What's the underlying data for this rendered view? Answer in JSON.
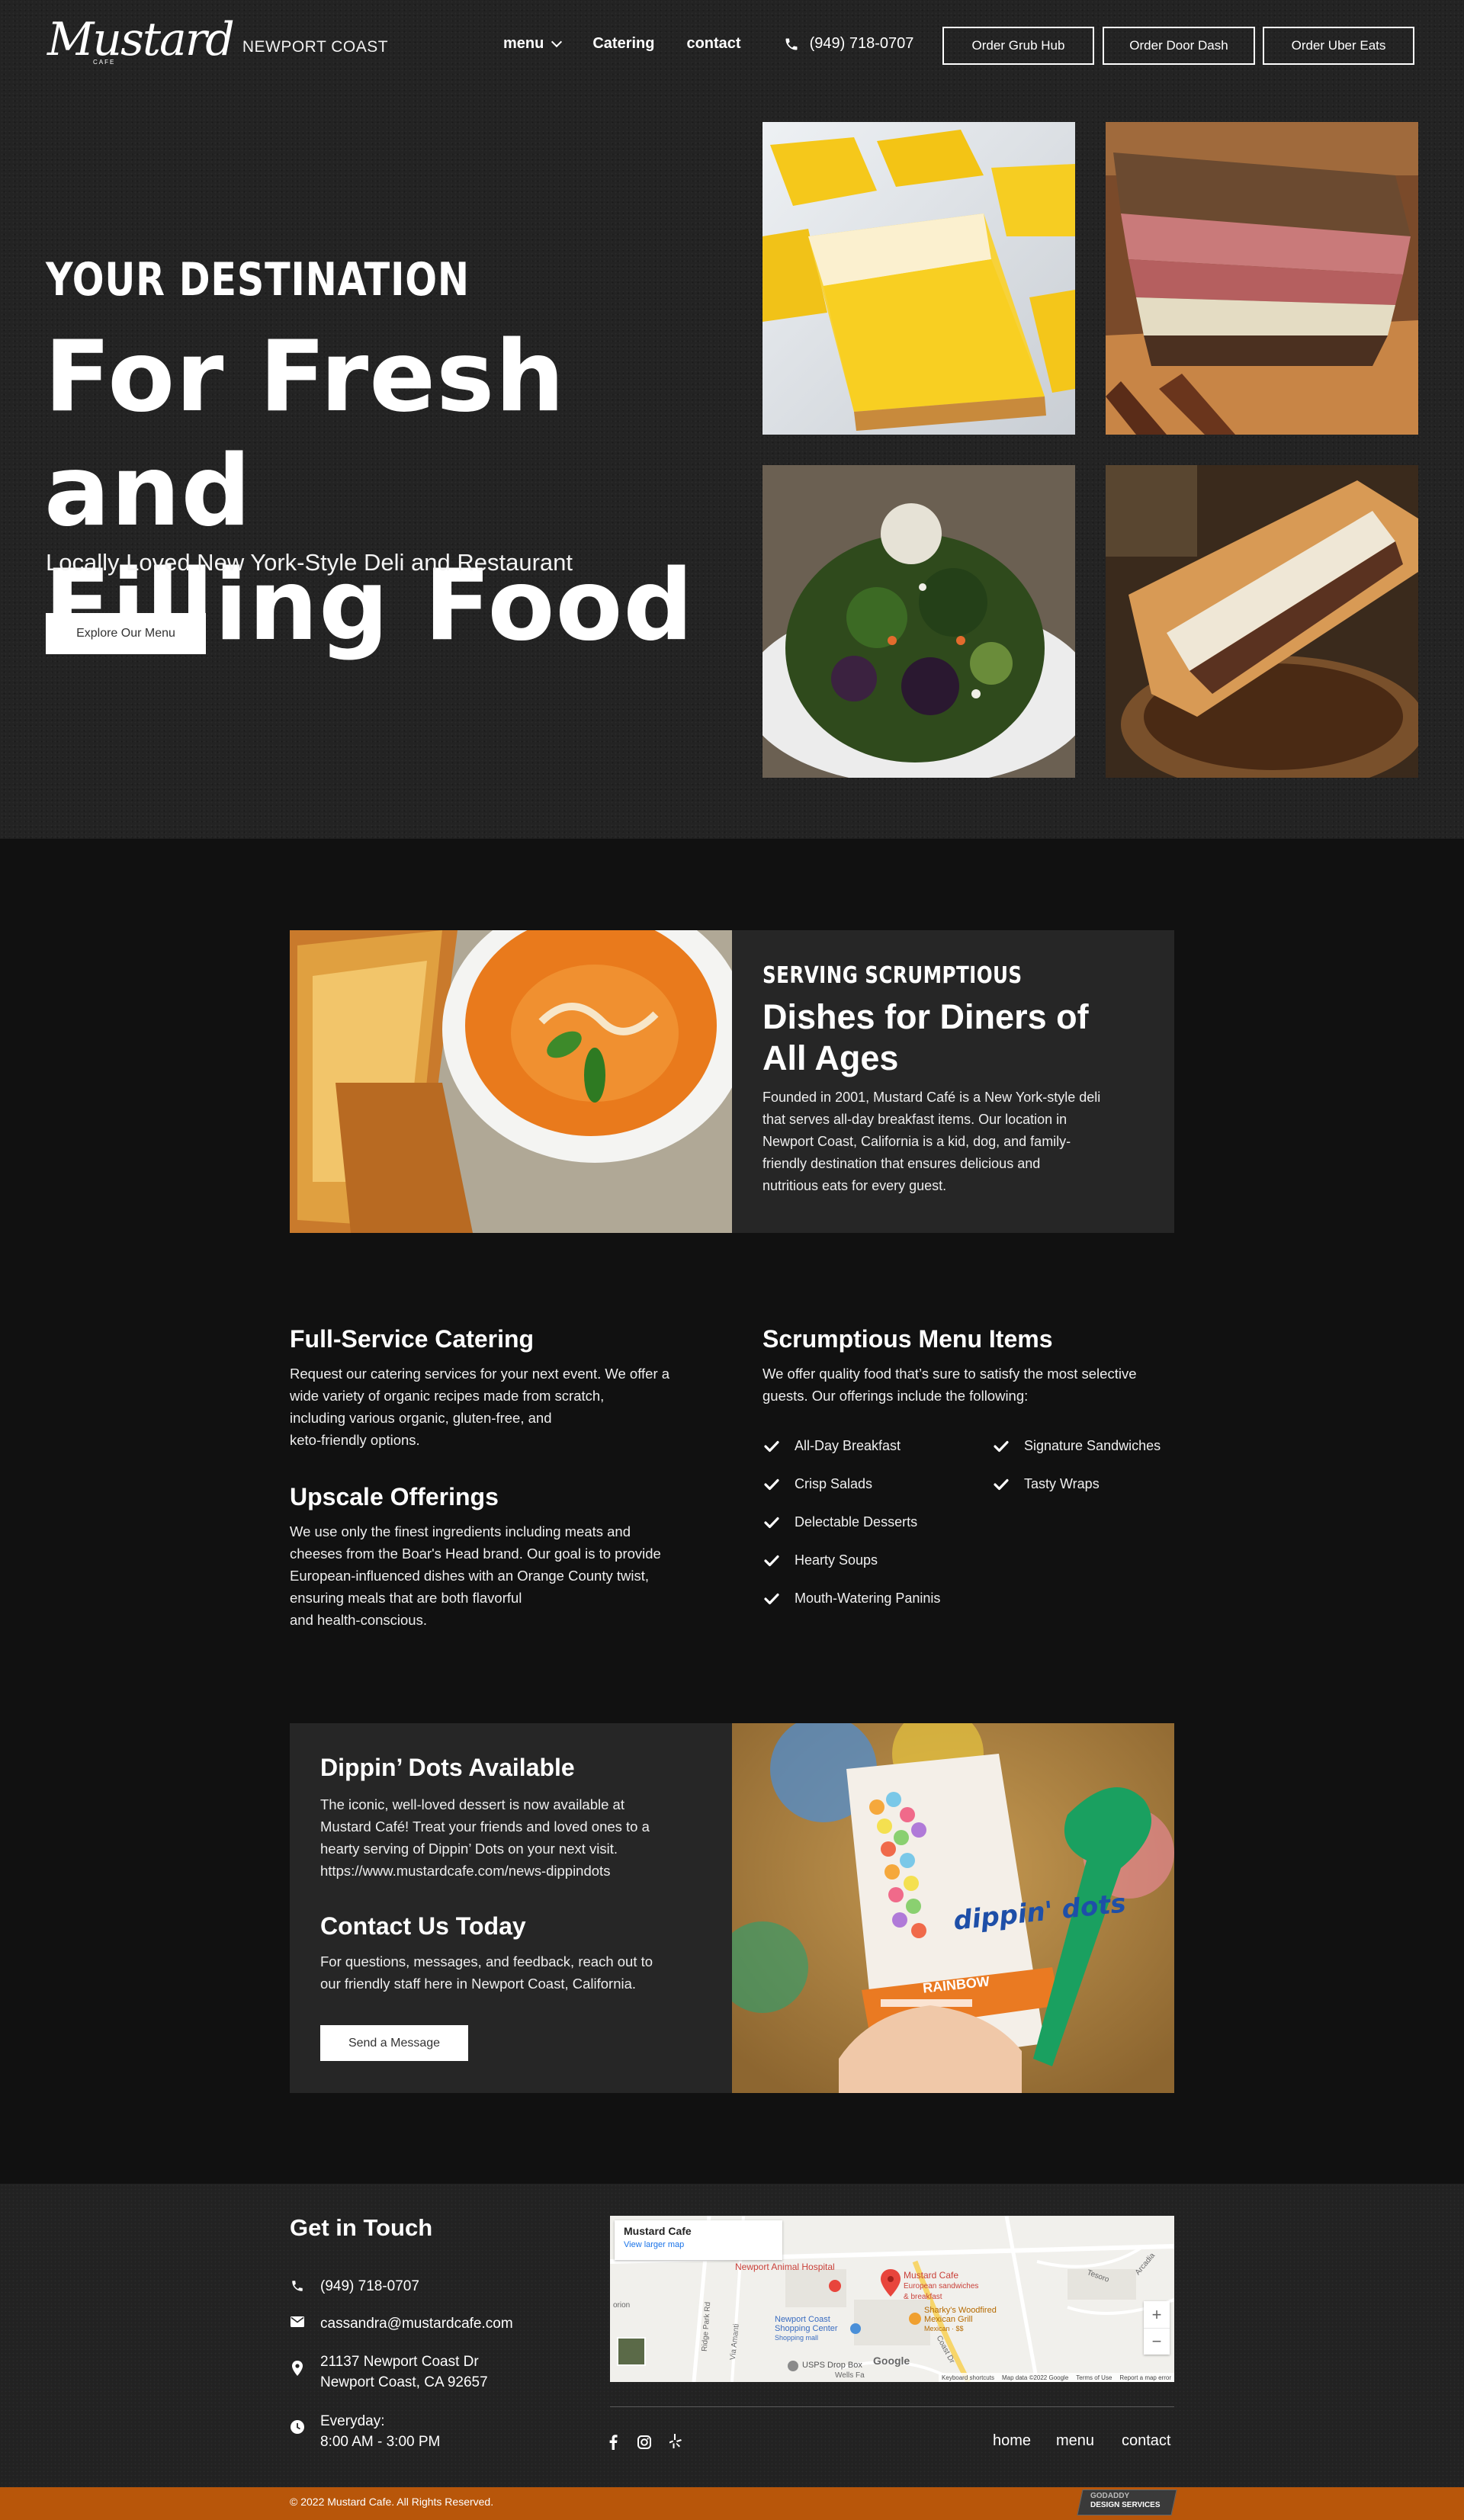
{
  "header": {
    "logo_script": "Mustard",
    "logo_cafe": "CAFE",
    "logo_tag": "NEWPORT COAST",
    "nav": [
      "menu",
      "Catering",
      "contact"
    ],
    "phone": "(949) 718-0707",
    "order_buttons": [
      "Order Grub Hub",
      "Order Door Dash",
      "Order Uber Eats"
    ]
  },
  "hero": {
    "eyebrow": "YOUR DESTINATION",
    "title_line1": "For Fresh and",
    "title_line2": "Filling Food",
    "subtitle": "Locally Loved New York-Style Deli and Restaurant",
    "cta": "Explore Our Menu"
  },
  "about": {
    "eyebrow": "SERVING SCRUMPTIOUS",
    "title_line1": "Dishes for Diners of",
    "title_line2": "All Ages",
    "body_lines": [
      "Founded in 2001, Mustard Café is a New York-style deli",
      "that serves all-day breakfast items. Our location in",
      "Newport Coast, California is a kid, dog, and family-",
      "friendly destination that ensures delicious and",
      "nutritious eats for every guest."
    ]
  },
  "catering": {
    "title": "Full-Service Catering",
    "body_lines": [
      "Request our catering services for your next event. We offer a",
      "wide variety of organic recipes made from scratch,",
      "including various organic, gluten-free, and",
      "keto-friendly options."
    ]
  },
  "upscale": {
    "title": "Upscale Offerings",
    "body_lines": [
      "We use only the finest ingredients including meats and",
      "cheeses from the Boar's Head brand. Our goal is to provide",
      "European-influenced dishes with an Orange County twist,",
      "ensuring meals that are both flavorful",
      "and health-conscious."
    ]
  },
  "menu_items": {
    "title": "Scrumptious Menu Items",
    "body_lines": [
      "We offer quality food that’s sure to satisfy the most selective",
      "guests. Our offerings include the following:"
    ],
    "col1": [
      "All-Day Breakfast",
      "Crisp Salads",
      "Delectable Desserts",
      "Hearty Soups",
      "Mouth-Watering Paninis"
    ],
    "col2": [
      "Signature Sandwiches",
      "Tasty Wraps"
    ]
  },
  "dippin": {
    "title": "Dippin’ Dots Available",
    "body_lines": [
      "The iconic, well-loved dessert is now available at",
      "Mustard Café! Treat your friends and loved ones to a",
      "hearty serving of Dippin’ Dots on your next visit.",
      "https://www.mustardcafe.com/news-dippindots"
    ],
    "brand_text": "dippin' dots",
    "flavor": "RAINBOW",
    "contact_title": "Contact Us Today",
    "contact_lines": [
      "For questions, messages, and feedback, reach out to",
      "our friendly staff here in Newport Coast, California."
    ],
    "cta": "Send a Message"
  },
  "footer": {
    "title": "Get in Touch",
    "phone": "(949) 718-0707",
    "email": "cassandra@mustardcafe.com",
    "address_line1": "21137 Newport Coast Dr",
    "address_line2": "Newport Coast, CA 92657",
    "hours_line1": "Everyday:",
    "hours_line2": "8:00 AM - 3:00 PM",
    "links": [
      "home",
      "menu",
      "contact"
    ],
    "copyright": "© 2022 Mustard Cafe. All Rights Reserved.",
    "badge_line1": "GODADDY",
    "badge_line2": "DESIGN SERVICES"
  },
  "map": {
    "place_name": "Mustard Cafe",
    "view_larger": "View larger map",
    "pin_label": "Mustard Cafe",
    "pin_sub1": "European sandwiches",
    "pin_sub2": "& breakfast",
    "hospital": "Newport Animal Hospital",
    "shopping1": "Newport Coast",
    "shopping2": "Shopping Center",
    "shopping3": "Shopping mall",
    "sharky1": "Sharky's Woodfired",
    "sharky2": "Mexican Grill",
    "sharky3": "Mexican · $$",
    "usps": "USPS Drop Box",
    "street1": "Ridge Park Rd",
    "street2": "Via Amanti",
    "street3": "Coast Dr",
    "street4": "Tesoro",
    "street5": "Arcadia",
    "street6": "Wells Fa",
    "orion": "orion",
    "google": "Google",
    "attrib": [
      "Keyboard shortcuts",
      "Map data ©2022 Google",
      "Terms of Use",
      "Report a map error"
    ],
    "zoom_in": "+",
    "zoom_out": "−"
  },
  "colors": {
    "hero_bg": "#232323",
    "page_bg": "#111111",
    "card_bg": "#262626",
    "footer_bar": "#b8560a",
    "map_pin": "#e8453c"
  },
  "icons": [
    "chevron-down-icon",
    "phone-icon",
    "check-icon",
    "envelope-icon",
    "map-pin-icon",
    "clock-icon",
    "facebook-icon",
    "instagram-icon",
    "yelp-icon"
  ]
}
